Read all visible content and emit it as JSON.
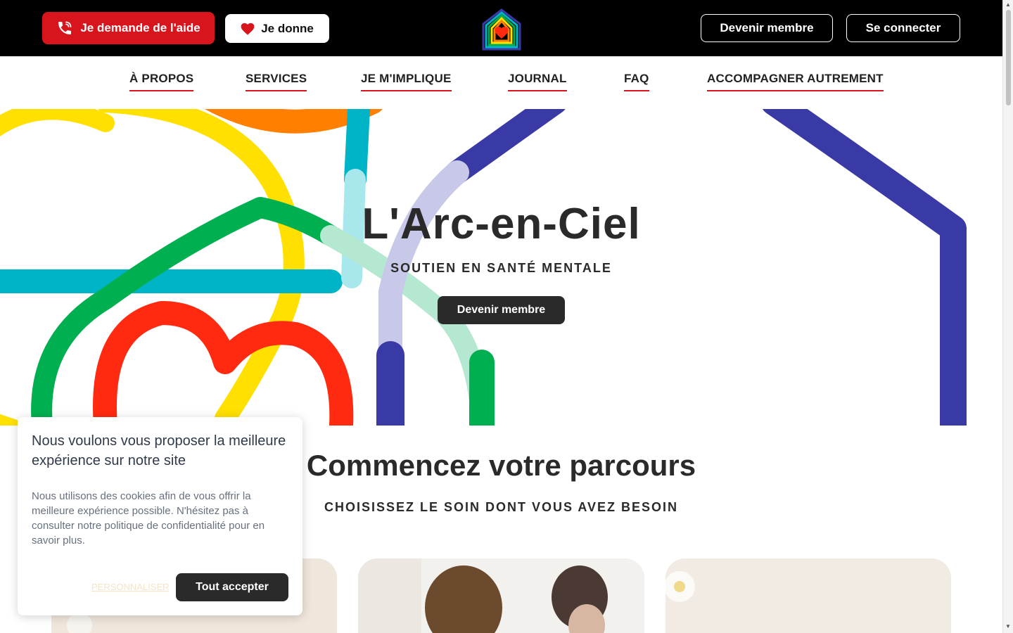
{
  "colors": {
    "topbar": "#000000",
    "accent_red": "#d8141d",
    "dark": "#2a2a2a",
    "rainbow": [
      "#ffe000",
      "#ff7f00",
      "#00b4c8",
      "#00b050",
      "#ff2a10",
      "#3a3aa6",
      "#c8c8e8",
      "#b4e8d0"
    ]
  },
  "topbar": {
    "help_label": "Je demande de l'aide",
    "help_icon": "phone-icon",
    "give_label": "Je donne",
    "give_icon": "heart-icon",
    "logo_icon": "rainbow-house-heart-logo",
    "member_label": "Devenir membre",
    "login_label": "Se connecter"
  },
  "nav": {
    "items": [
      {
        "label": "À PROPOS"
      },
      {
        "label": "SERVICES"
      },
      {
        "label": "JE M'IMPLIQUE"
      },
      {
        "label": "JOURNAL"
      },
      {
        "label": "FAQ"
      },
      {
        "label": "ACCOMPAGNER AUTREMENT"
      }
    ]
  },
  "hero": {
    "title": "L'Arc-en-Ciel",
    "subtitle": "SOUTIEN EN SANTÉ MENTALE",
    "cta_label": "Devenir membre"
  },
  "section": {
    "title": "Commencez votre parcours",
    "subtitle": "CHOISISSEZ LE SOIN DONT VOUS AVEZ BESOIN"
  },
  "cookie": {
    "title": "Nous voulons vous proposer la meilleure expérience sur notre site",
    "text": "Nous utilisons des cookies afin de vous offrir la meilleure expérience possible. N'hésitez pas à consulter notre politique de confidentialité pour en savoir plus.",
    "customize_label": "PERSONNALISER",
    "accept_label": "Tout accepter"
  }
}
